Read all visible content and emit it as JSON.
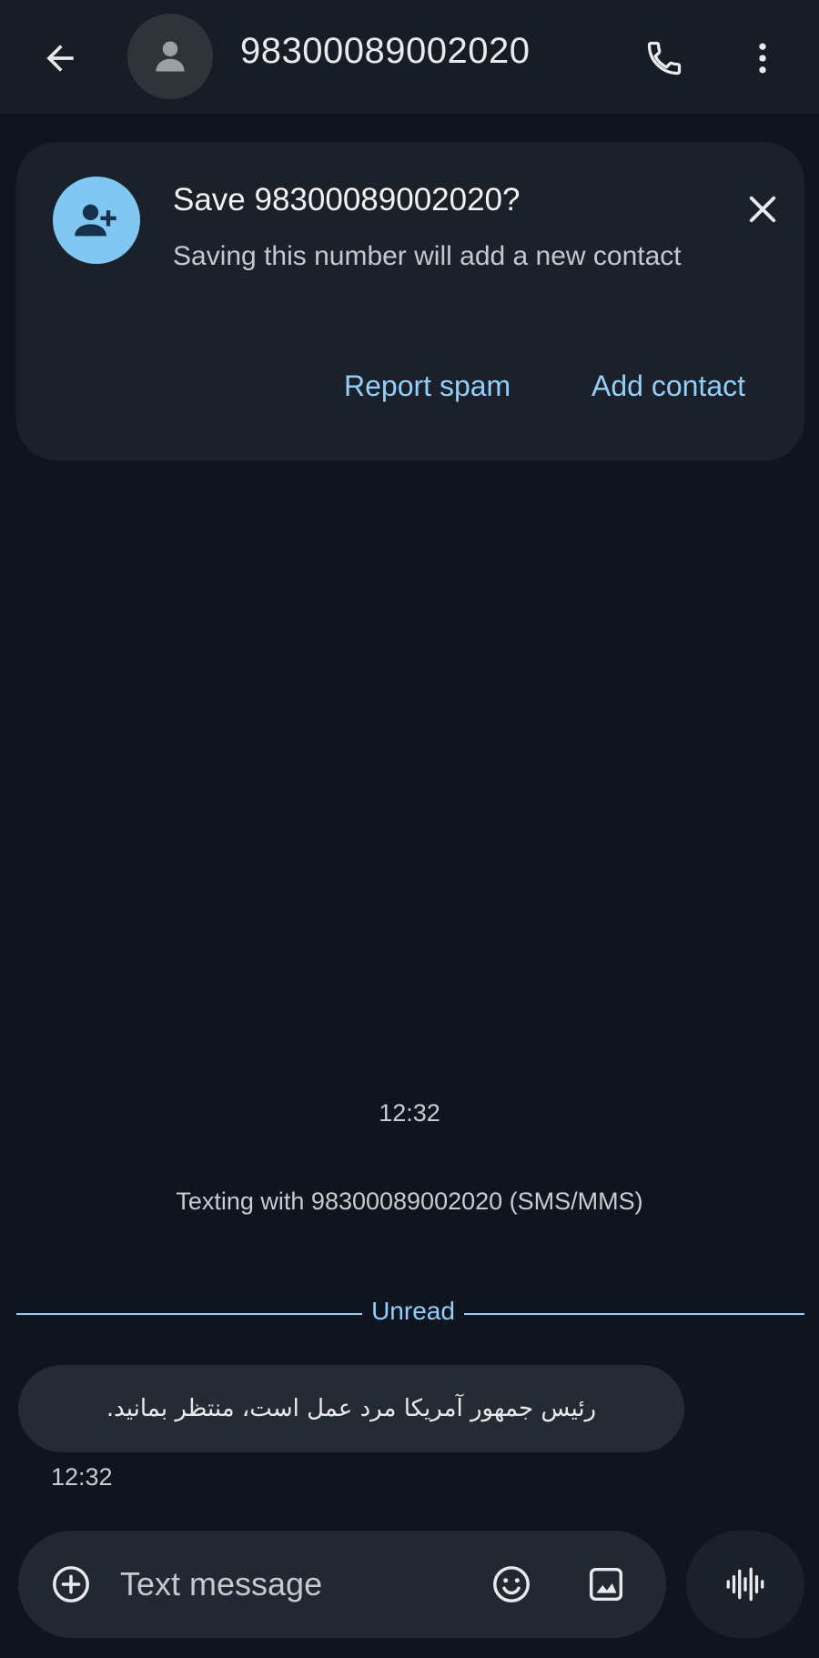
{
  "header": {
    "title": "98300089002020",
    "back_icon": "arrow-back-icon",
    "avatar_icon": "person-icon",
    "call_icon": "phone-icon",
    "more_icon": "more-vert-icon"
  },
  "save_card": {
    "title": "Save 98300089002020?",
    "subtitle": "Saving this number will add a new contact",
    "icon": "person-add-icon",
    "close_icon": "close-icon",
    "report_spam_label": "Report spam",
    "add_contact_label": "Add contact"
  },
  "conversation": {
    "start_time": "12:32",
    "texting_info": "Texting with 98300089002020 (SMS/MMS)",
    "unread_label": "Unread",
    "messages": [
      {
        "text": "رئیس جمهور آمریکا مرد عمل است، منتظر بمانید.",
        "time": "12:32"
      }
    ]
  },
  "composer": {
    "placeholder": "Text message",
    "value": "",
    "add_icon": "add-circle-icon",
    "emoji_icon": "emoji-icon",
    "image_icon": "image-icon",
    "voice_icon": "voice-waveform-icon"
  },
  "colors": {
    "background": "#0f151d",
    "card": "#1b2029",
    "accent": "#8ed0ff",
    "card_avatar": "#7fc8f2",
    "bubble": "#262b33"
  }
}
